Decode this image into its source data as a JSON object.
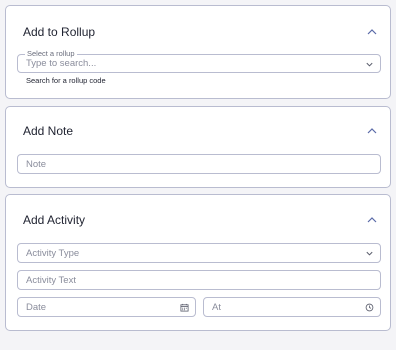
{
  "rollup": {
    "title": "Add to Rollup",
    "select_label": "Select a rollup",
    "search_placeholder": "Type to search...",
    "helper_text": "Search for a rollup code"
  },
  "note": {
    "title": "Add Note",
    "note_placeholder": "Note"
  },
  "activity": {
    "title": "Add Activity",
    "type_placeholder": "Activity Type",
    "text_placeholder": "Activity Text",
    "date_placeholder": "Date",
    "at_placeholder": "At"
  },
  "icons": {
    "collapse": "chevron-up-icon",
    "dropdown": "chevron-down-icon",
    "calendar": "calendar-icon",
    "clock": "clock-icon"
  },
  "colors": {
    "border": "#b9bcd0",
    "accent": "#5a6aa8",
    "text": "#1f2230",
    "placeholder": "#8a8d9c"
  }
}
